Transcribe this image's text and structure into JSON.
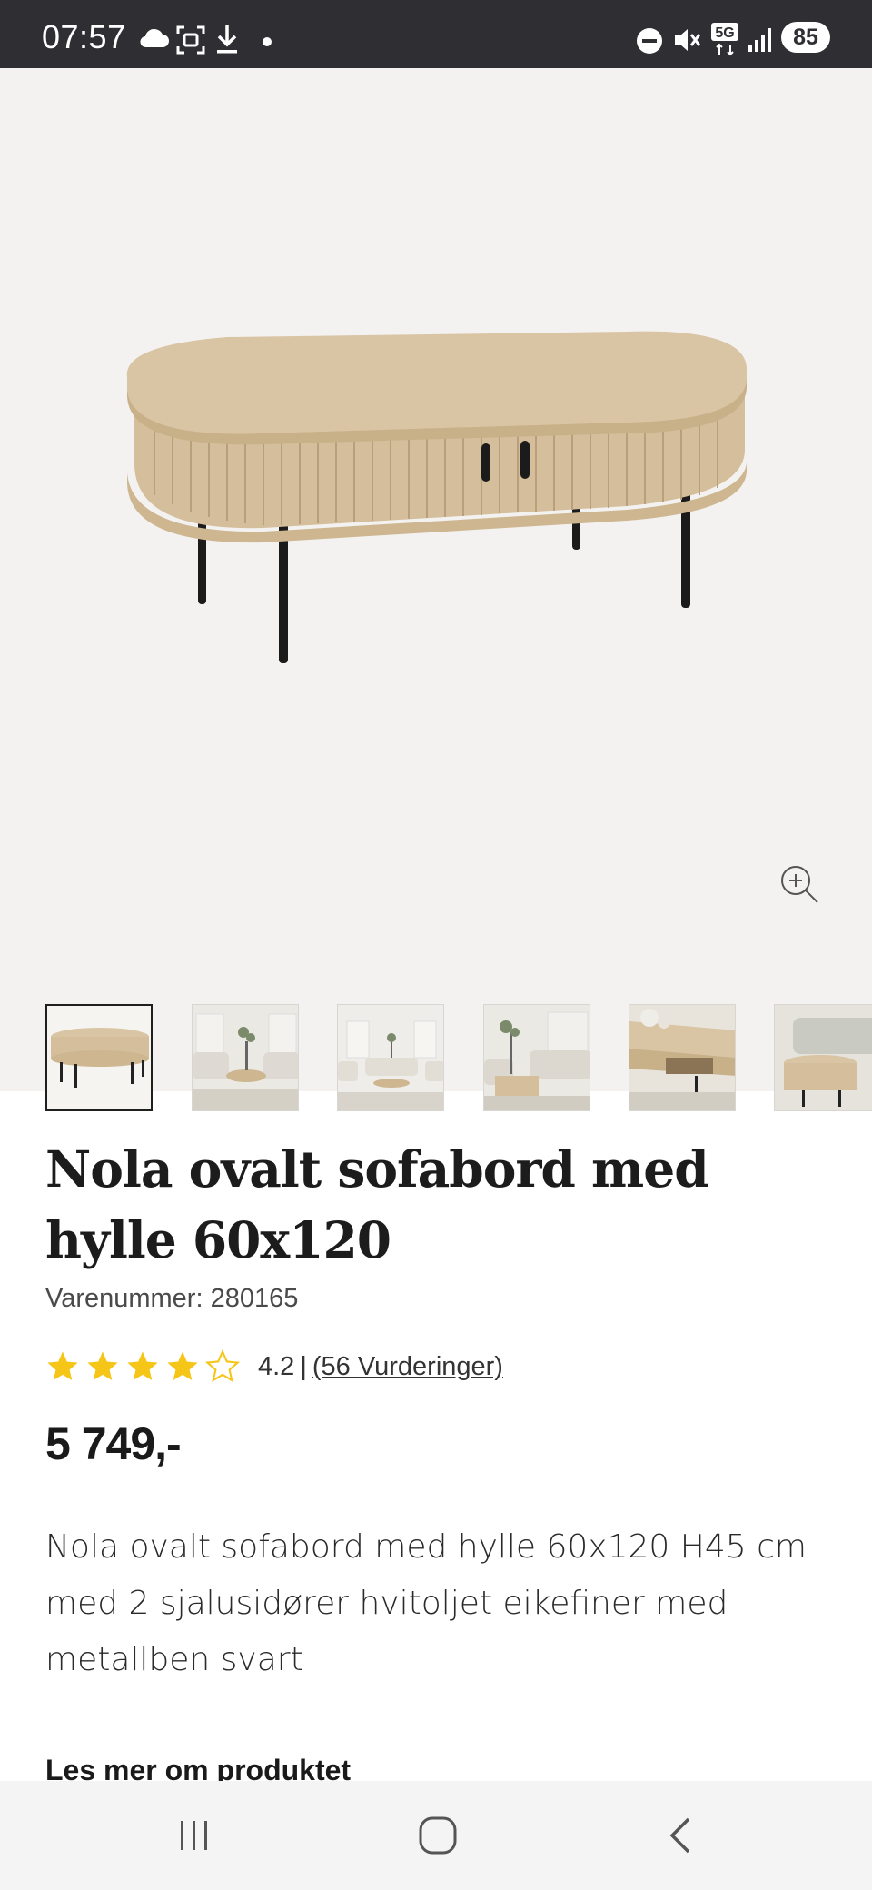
{
  "status_bar": {
    "time": "07:57",
    "icons": [
      "cloud-icon",
      "screenshot-icon",
      "download-icon",
      "dot-icon",
      "dnd-icon",
      "mute-icon",
      "5g-icon",
      "signal-icon"
    ],
    "network": "5G",
    "battery": "85"
  },
  "gallery": {
    "main_image": "oval-coffee-table-photo",
    "zoom_icon": "zoom-in-icon",
    "thumbnails": [
      {
        "name": "table-front",
        "active": true
      },
      {
        "name": "living-room-1",
        "active": false
      },
      {
        "name": "living-room-2",
        "active": false
      },
      {
        "name": "living-room-3",
        "active": false
      },
      {
        "name": "table-detail",
        "active": false
      },
      {
        "name": "table-side",
        "active": false
      }
    ]
  },
  "product": {
    "title": "Nola ovalt sofabord med hylle 60x120",
    "sku": "Varenummer: 280165",
    "rating_value": "4.2",
    "rating_separator": "|",
    "rating_count": "(56 Vurderinger)",
    "stars_filled": 4,
    "stars_total": 5,
    "price": "5 749,-",
    "description": "Nola ovalt sofabord med hylle 60x120 H45 cm med 2 sjalusidører hvitoljet eikefiner med metallben svart",
    "read_more": "Les mer om produktet"
  },
  "colors": {
    "status_bar": "#2f2f33",
    "gallery_bg": "#f3f2f0",
    "star": "#f5c518",
    "wood": "#d9c4a3",
    "nav_bg": "#f4f4f4"
  },
  "nav_bar": {
    "buttons": [
      "recent-apps-icon",
      "home-icon",
      "back-icon"
    ]
  }
}
